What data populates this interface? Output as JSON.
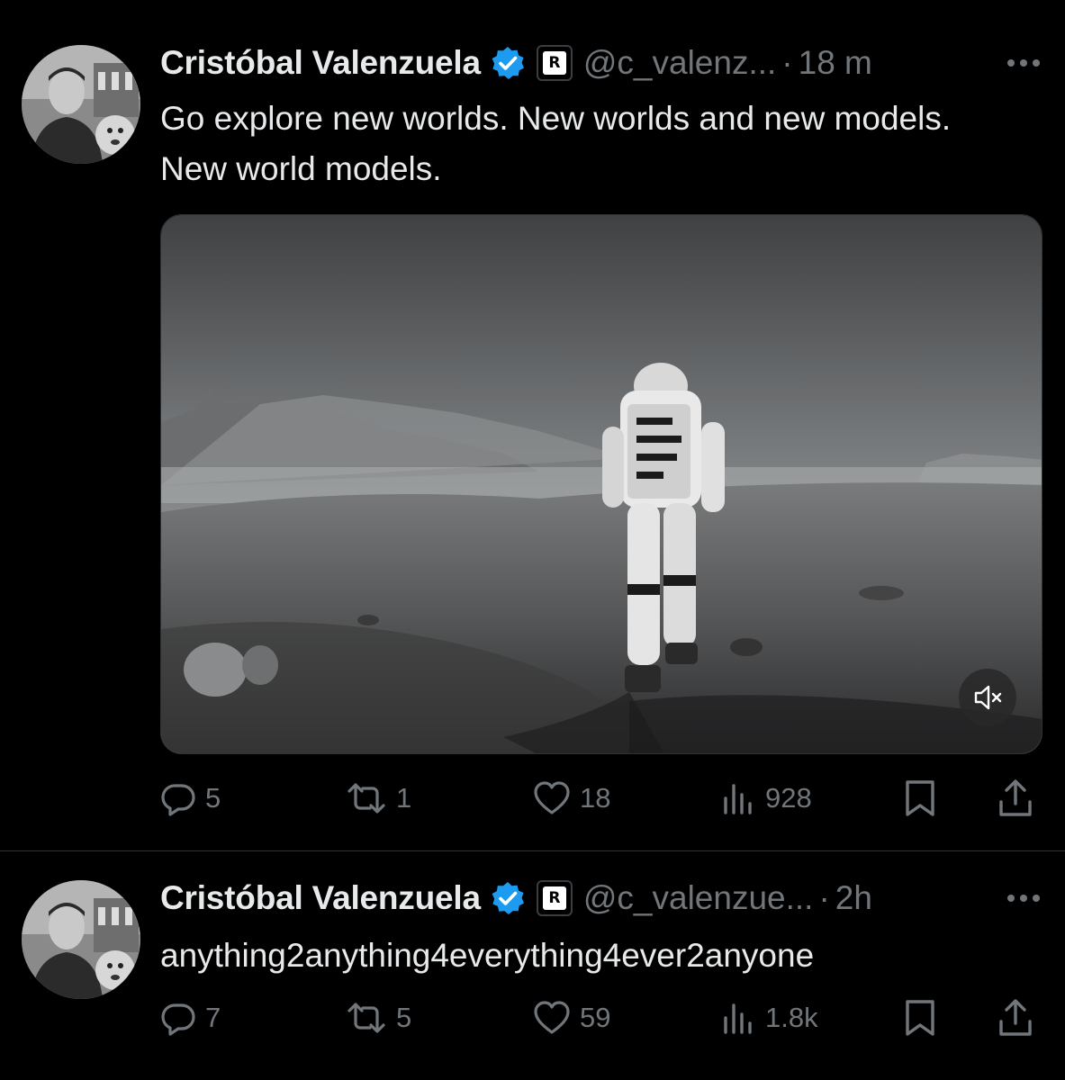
{
  "tweets": [
    {
      "author_name": "Cristóbal Valenzuela",
      "badge_letter": "R",
      "handle": "@c_valenz...",
      "dot": "·",
      "time": "18 m",
      "text": "Go explore new worlds. New worlds and new models. New world models.",
      "counts": {
        "replies": "5",
        "retweets": "1",
        "likes": "18",
        "views": "928"
      }
    },
    {
      "author_name": "Cristóbal Valenzuela",
      "badge_letter": "R",
      "handle": "@c_valenzue...",
      "dot": "·",
      "time": "2h",
      "text": "anything2anything4everything4ever2anyone",
      "counts": {
        "replies": "7",
        "retweets": "5",
        "likes": "59",
        "views": "1.8k"
      }
    }
  ],
  "icons": {
    "verified": "verified-badge-icon",
    "more": "more-icon",
    "reply": "reply-icon",
    "retweet": "retweet-icon",
    "like": "like-icon",
    "views": "views-icon",
    "bookmark": "bookmark-icon",
    "share": "share-icon",
    "mute": "mute-icon"
  },
  "colors": {
    "background": "#000000",
    "text_primary": "#e7e9ea",
    "text_secondary": "#71767b",
    "verified_blue": "#1d9bf0",
    "divider": "#2f3336"
  }
}
